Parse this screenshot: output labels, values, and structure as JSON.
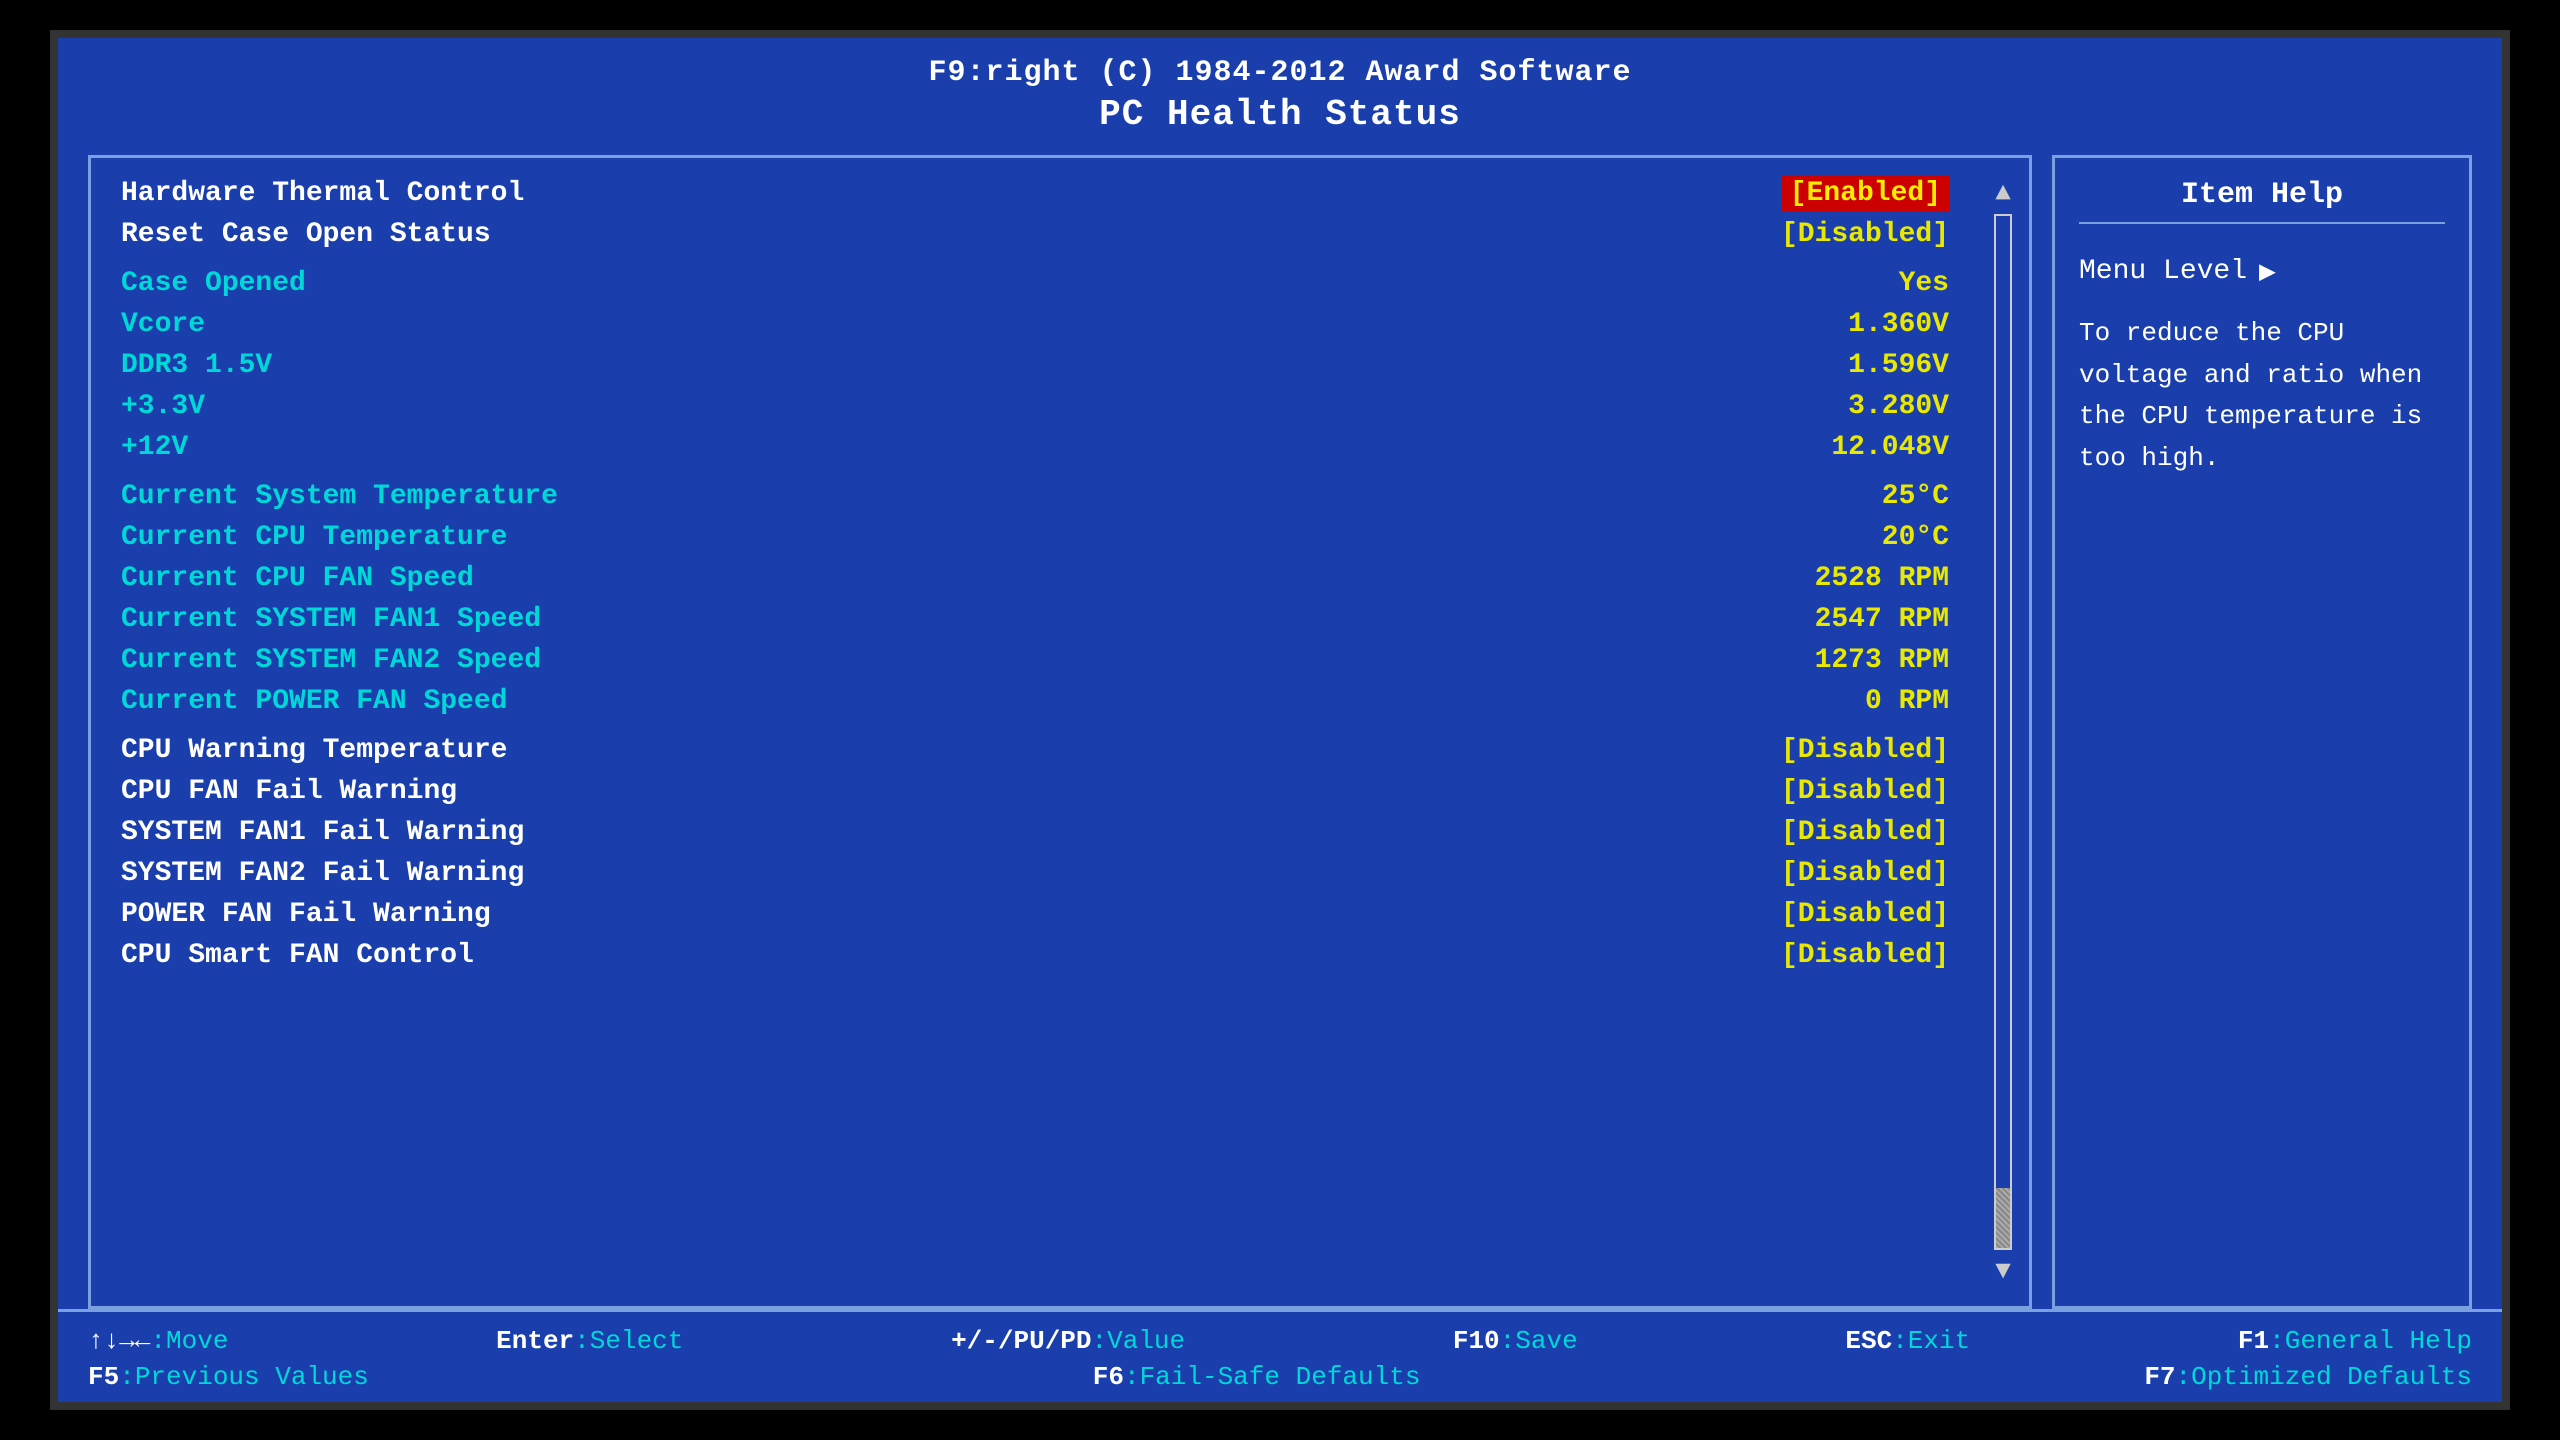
{
  "header": {
    "line1": "F9:right (C) 1984-2012 Award Software",
    "line2": "PC Health Status"
  },
  "left_panel": {
    "rows": [
      {
        "label": "Hardware Thermal Control",
        "value": "",
        "label_color": "white",
        "value_color": "yellow",
        "value_type": "enabled"
      },
      {
        "label": "Reset Case Open Status",
        "value": "",
        "label_color": "white",
        "value_color": "yellow",
        "value_type": "disabled"
      },
      {
        "label": "Case Opened",
        "value": "Yes",
        "label_color": "cyan",
        "value_color": "yellow"
      },
      {
        "label": "Vcore",
        "value": "1.360V",
        "label_color": "cyan",
        "value_color": "yellow"
      },
      {
        "label": "DDR3 1.5V",
        "value": "1.596V",
        "label_color": "cyan",
        "value_color": "yellow"
      },
      {
        "label": "+3.3V",
        "value": "3.280V",
        "label_color": "cyan",
        "value_color": "yellow"
      },
      {
        "label": "+12V",
        "value": "12.048V",
        "label_color": "cyan",
        "value_color": "yellow"
      },
      {
        "label": "Current System Temperature",
        "value": "25°C",
        "label_color": "cyan",
        "value_color": "yellow"
      },
      {
        "label": "Current CPU Temperature",
        "value": "20°C",
        "label_color": "cyan",
        "value_color": "yellow"
      },
      {
        "label": "Current CPU FAN Speed",
        "value": "2528 RPM",
        "label_color": "cyan",
        "value_color": "yellow"
      },
      {
        "label": "Current SYSTEM FAN1 Speed",
        "value": "2547 RPM",
        "label_color": "cyan",
        "value_color": "yellow"
      },
      {
        "label": "Current SYSTEM FAN2 Speed",
        "value": "1273 RPM",
        "label_color": "cyan",
        "value_color": "yellow"
      },
      {
        "label": "Current POWER FAN Speed",
        "value": "0 RPM",
        "label_color": "cyan",
        "value_color": "yellow"
      },
      {
        "label": "CPU Warning Temperature",
        "value": "[Disabled]",
        "label_color": "white",
        "value_color": "yellow"
      },
      {
        "label": "CPU FAN Fail Warning",
        "value": "[Disabled]",
        "label_color": "white",
        "value_color": "yellow"
      },
      {
        "label": "SYSTEM FAN1 Fail Warning",
        "value": "[Disabled]",
        "label_color": "white",
        "value_color": "yellow"
      },
      {
        "label": "SYSTEM FAN2 Fail Warning",
        "value": "[Disabled]",
        "label_color": "white",
        "value_color": "yellow"
      },
      {
        "label": "POWER FAN Fail Warning",
        "value": "[Disabled]",
        "label_color": "white",
        "value_color": "yellow"
      },
      {
        "label": "CPU Smart FAN Control",
        "value": "[Disabled]",
        "label_color": "white",
        "value_color": "yellow"
      }
    ],
    "enabled_label": "[Enabled]",
    "disabled_label": "[Disabled]"
  },
  "right_panel": {
    "title": "Item Help",
    "menu_level_label": "Menu Level",
    "menu_level_arrow": "▶",
    "help_text": "To reduce the CPU voltage and ratio when the CPU temperature is too high."
  },
  "bottom_bar": {
    "row1": [
      {
        "key": "↑↓→←:Move",
        "label": ""
      },
      {
        "key": "Enter:Select",
        "label": ""
      },
      {
        "key": "+/-/PU/PD:Value",
        "label": ""
      },
      {
        "key": "F10:Save",
        "label": ""
      },
      {
        "key": "ESC:Exit",
        "label": ""
      },
      {
        "key": "F1:General Help",
        "label": ""
      }
    ],
    "row2": [
      {
        "key": "F5:Previous Values",
        "label": ""
      },
      {
        "key": "F6:Fail-Safe Defaults",
        "label": ""
      },
      {
        "key": "F7:Optimized Defaults",
        "label": ""
      }
    ]
  }
}
